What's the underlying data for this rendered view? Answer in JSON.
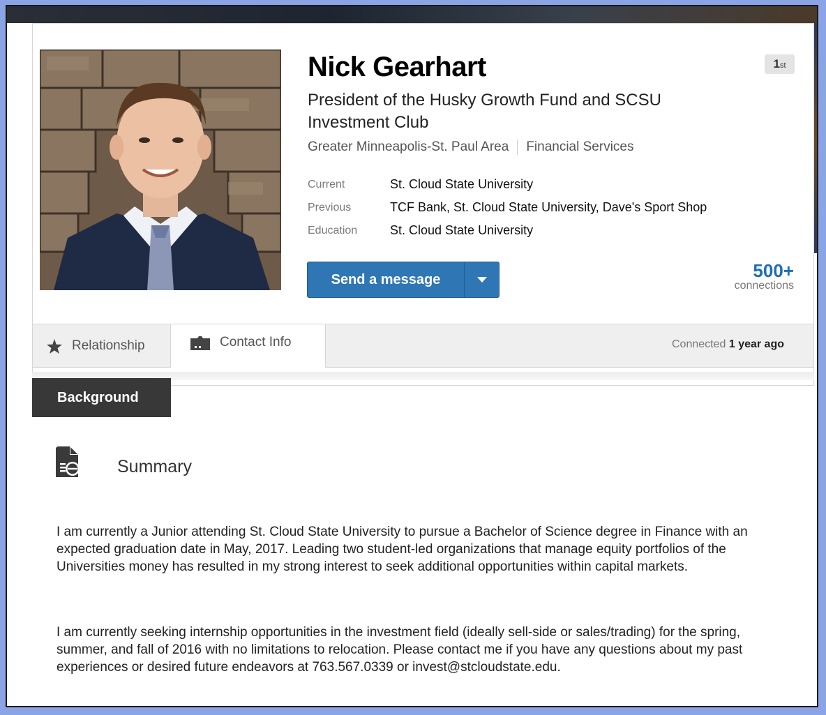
{
  "profile": {
    "name": "Nick Gearhart",
    "degree_num": "1",
    "degree_suffix": "st",
    "headline": "President of the Husky Growth Fund and SCSU Investment Club",
    "location": "Greater Minneapolis-St. Paul Area",
    "industry": "Financial Services",
    "current_label": "Current",
    "current_value": "St. Cloud State University",
    "previous_label": "Previous",
    "previous_value": "TCF Bank, St. Cloud State University, Dave's Sport Shop",
    "education_label": "Education",
    "education_value": "St. Cloud State University",
    "connections_count": "500+",
    "connections_label": "connections"
  },
  "actions": {
    "send_message_label": "Send a message"
  },
  "tabs": {
    "relationship_label": "Relationship",
    "contact_label": "Contact Info",
    "connected_prefix": "Connected",
    "connected_time": "1 year ago"
  },
  "background": {
    "tab_label": "Background",
    "summary_title": "Summary",
    "summary_p1": "I am currently a Junior attending St. Cloud State University to pursue a Bachelor of Science degree in Finance with an expected graduation date in May, 2017. Leading two student-led organizations that manage equity portfolios of the Universities money has resulted in my strong interest to seek additional opportunities within capital markets.",
    "summary_p2": "I am currently seeking internship opportunities in the investment field (ideally sell-side or sales/trading) for the spring, summer, and fall of 2016 with no limitations to relocation. Please contact me if you have any questions about my past experiences or desired future endeavors at 763.567.0339 or invest@stcloudstate.edu."
  },
  "colors": {
    "page_background": "#8aa4e6",
    "button_blue": "#2f77b4",
    "connections_blue": "#1d6fb3",
    "background_tab": "#383838"
  },
  "icons": [
    "star-icon",
    "contact-card-icon",
    "caret-down-icon",
    "summary-document-icon"
  ]
}
